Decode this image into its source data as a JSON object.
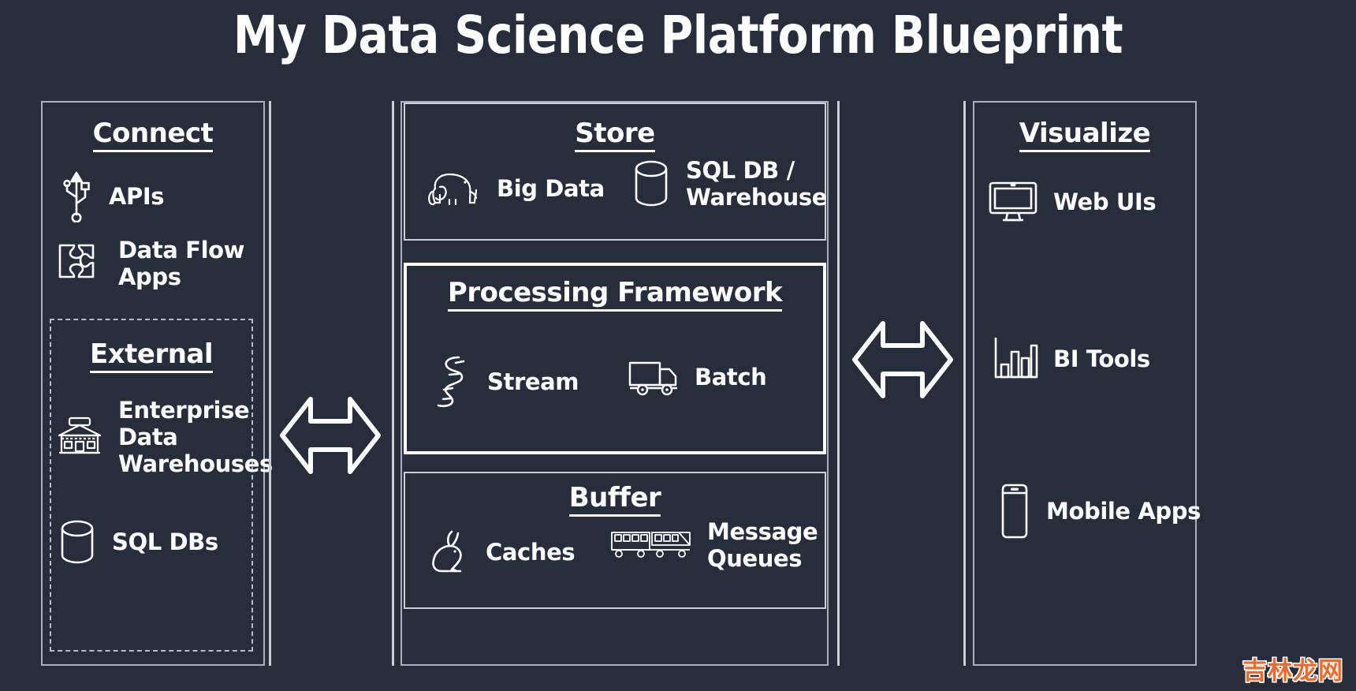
{
  "title": "My Data Science Platform Blueprint",
  "colors": {
    "background": "#272d3b",
    "stroke": "#ffffff",
    "border": "#c9cdd6",
    "watermark": "#ef6a2b"
  },
  "columns": {
    "connect": {
      "heading": "Connect",
      "items": [
        {
          "icon": "usb-icon",
          "label": "APIs"
        },
        {
          "icon": "puzzle-piece-icon",
          "label": "Data Flow\nApps"
        }
      ],
      "external": {
        "heading": "External",
        "items": [
          {
            "icon": "warehouse-building-icon",
            "label": "Enterprise\nData\nWarehouses"
          },
          {
            "icon": "database-cylinder-icon",
            "label": "SQL DBs"
          }
        ]
      }
    },
    "center": {
      "store": {
        "heading": "Store",
        "items": [
          {
            "icon": "elephant-icon",
            "label": "Big Data"
          },
          {
            "icon": "database-cylinder-icon",
            "label": "SQL DB /\nWarehouse"
          }
        ]
      },
      "processing": {
        "heading": "Processing Framework",
        "items": [
          {
            "icon": "winding-river-icon",
            "label": "Stream"
          },
          {
            "icon": "truck-icon",
            "label": "Batch"
          }
        ]
      },
      "buffer": {
        "heading": "Buffer",
        "items": [
          {
            "icon": "rabbit-icon",
            "label": "Caches"
          },
          {
            "icon": "train-icon",
            "label": "Message\nQueues"
          }
        ]
      }
    },
    "visualize": {
      "heading": "Visualize",
      "items": [
        {
          "icon": "monitor-icon",
          "label": "Web UIs"
        },
        {
          "icon": "bar-chart-icon",
          "label": "BI Tools"
        },
        {
          "icon": "mobile-phone-icon",
          "label": "Mobile Apps"
        }
      ]
    }
  },
  "connectors": [
    {
      "name": "connect-to-center-arrow",
      "type": "double-arrow-horizontal"
    },
    {
      "name": "center-to-visualize-arrow",
      "type": "double-arrow-horizontal"
    }
  ],
  "watermark": "吉林龙网"
}
